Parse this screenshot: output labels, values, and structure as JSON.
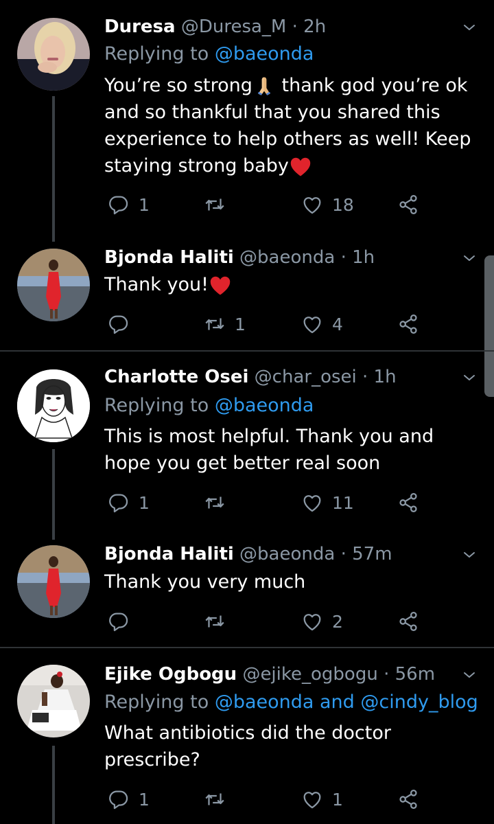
{
  "tweets": [
    {
      "name": "Duresa",
      "handle": "@Duresa_M",
      "dot": "·",
      "time": "2h",
      "replying_prefix": "Replying to",
      "replying_to": "@baeonda",
      "text_part1": "You’re so strong",
      "text_part2": " thank god you’re ok and so thankful that you shared this experience to help others as well! Keep staying strong baby",
      "emojis": [
        "folded-hands",
        "red-heart"
      ],
      "replies": "1",
      "retweets": "",
      "likes": "18"
    },
    {
      "name": "Bjonda Haliti",
      "handle": "@baeonda",
      "dot": "·",
      "time": "1h",
      "text": "Thank you!",
      "emojis": [
        "red-heart"
      ],
      "replies": "",
      "retweets": "1",
      "likes": "4"
    },
    {
      "name": "Charlotte Osei",
      "handle": "@char_osei",
      "dot": "·",
      "time": "1h",
      "replying_prefix": "Replying to",
      "replying_to": "@baeonda",
      "text": "This is most helpful. Thank you and hope you get better real soon",
      "replies": "1",
      "retweets": "",
      "likes": "11"
    },
    {
      "name": "Bjonda Haliti",
      "handle": "@baeonda",
      "dot": "·",
      "time": "57m",
      "text": "Thank you very much",
      "replies": "",
      "retweets": "",
      "likes": "2"
    },
    {
      "name": "Ejike Ogbogu",
      "handle": "@ejike_ogbogu",
      "dot": "·",
      "time": "56m",
      "replying_prefix": "Replying to",
      "replying_to": "@baeonda and @cindy_blog",
      "text": "What antibiotics did the doctor prescribe?",
      "replies": "1",
      "retweets": "",
      "likes": "1"
    }
  ],
  "colors": {
    "background": "#000000",
    "mention": "#2f9bef",
    "secondary_text": "#8b98a5",
    "thread_line": "#3a3f44",
    "divider": "#2f3336"
  },
  "icons": [
    "reply-icon",
    "retweet-icon",
    "like-icon",
    "share-icon",
    "chevron-down-icon"
  ]
}
